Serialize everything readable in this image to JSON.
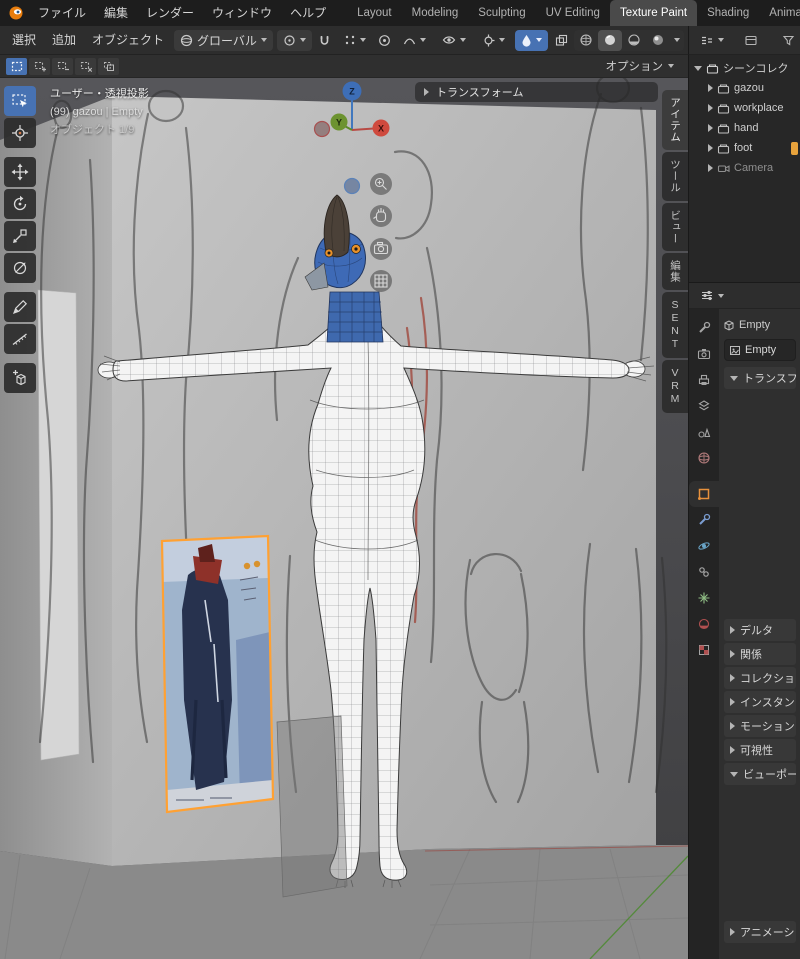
{
  "topbar": {
    "menus": [
      "ファイル",
      "編集",
      "レンダー",
      "ウィンドウ",
      "ヘルプ"
    ],
    "workspaces": [
      "Layout",
      "Modeling",
      "Sculpting",
      "UV Editing",
      "Texture Paint",
      "Shading",
      "Anima"
    ],
    "active_workspace": "Texture Paint"
  },
  "viewport_header": {
    "menus": [
      "選択",
      "追加",
      "オブジェクト"
    ],
    "orientation": "グローバル",
    "options_label": "オプション"
  },
  "viewport": {
    "view_label": "ユーザー・透視投影",
    "context_label": "(99) gazou | Empty",
    "mode_label": "オブジェクト 1/9",
    "transform_panel_label": "トランスフォーム",
    "axis_x": "X",
    "axis_y": "Y",
    "axis_z": "Z",
    "side_tabs": [
      "アイテム",
      "ツール",
      "ビュー",
      "編集",
      "SENT",
      "VRM"
    ],
    "active_side_tab": "アイテム"
  },
  "outliner": {
    "root_label": "シーンコレク",
    "items": [
      "gazou",
      "workplace",
      "hand",
      "foot",
      "Camera"
    ]
  },
  "properties": {
    "breadcrumb_object": "Empty",
    "object_name": "Empty",
    "tabs": [
      "tool",
      "render",
      "output",
      "view-layer",
      "scene",
      "world",
      "object",
      "modifiers",
      "physics",
      "constraints",
      "object-data",
      "material",
      "texture"
    ],
    "sections": {
      "transform": "トランスフ",
      "delta": "デルタ",
      "relations": "関係",
      "collections": "コレクショ",
      "instancing": "インスタン",
      "motion_paths": "モーション",
      "visibility": "可視性",
      "viewport_display": "ビューポー",
      "animation": "アニメーシ"
    }
  },
  "colors": {
    "accent_blue": "#4772b3",
    "selection_orange": "#ffa133",
    "axis_x_red": "#cf4a3e",
    "axis_y_green": "#6d9330",
    "axis_z_blue": "#3d6eb7",
    "mesh_white": "#f4f4f4",
    "head_blue": "#3e6ab6"
  }
}
